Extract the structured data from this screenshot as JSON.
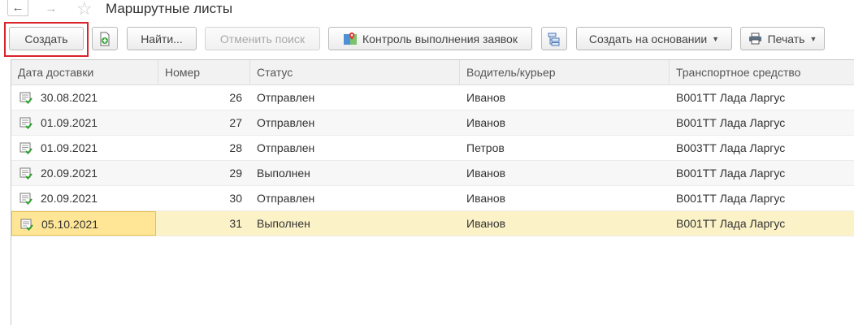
{
  "window": {
    "title": "Маршрутные листы"
  },
  "toolbar": {
    "create": "Создать",
    "find": "Найти...",
    "cancel_search": "Отменить поиск",
    "control": "Контроль выполнения заявок",
    "create_based_on": "Создать на основании",
    "print": "Печать"
  },
  "table": {
    "columns": [
      "Дата доставки",
      "Номер",
      "Статус",
      "Водитель/курьер",
      "Транспортное средство"
    ],
    "rows": [
      {
        "date": "30.08.2021",
        "number": "26",
        "status": "Отправлен",
        "driver": "Иванов",
        "vehicle": "В001ТТ Лада Ларгус"
      },
      {
        "date": "01.09.2021",
        "number": "27",
        "status": "Отправлен",
        "driver": "Иванов",
        "vehicle": "В001ТТ Лада Ларгус"
      },
      {
        "date": "01.09.2021",
        "number": "28",
        "status": "Отправлен",
        "driver": "Петров",
        "vehicle": "В003ТТ Лада Ларгус"
      },
      {
        "date": "20.09.2021",
        "number": "29",
        "status": "Выполнен",
        "driver": "Иванов",
        "vehicle": "В001ТТ Лада Ларгус"
      },
      {
        "date": "20.09.2021",
        "number": "30",
        "status": "Отправлен",
        "driver": "Иванов",
        "vehicle": "В001ТТ Лада Ларгус"
      },
      {
        "date": "05.10.2021",
        "number": "31",
        "status": "Выполнен",
        "driver": "Иванов",
        "vehicle": "В001ТТ Лада Ларгус"
      }
    ]
  },
  "icons": {
    "back": "arrow-left-icon",
    "forward": "arrow-right-icon",
    "favorite": "star-icon",
    "copy": "copy-document-icon",
    "map": "map-pin-icon",
    "structure": "structure-icon",
    "print": "printer-icon",
    "row": "posted-document-icon"
  },
  "colors": {
    "highlight": "#d9232b",
    "selected_row": "#fcf2c7",
    "selected_cell": "#ffe696",
    "check": "#2aa02a"
  }
}
